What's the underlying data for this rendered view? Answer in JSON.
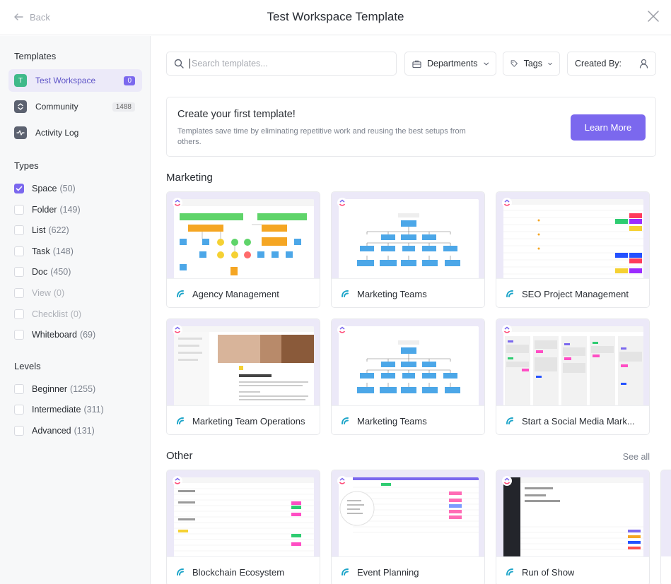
{
  "header": {
    "back_label": "Back",
    "title": "Test Workspace Template"
  },
  "sidebar": {
    "templates_title": "Templates",
    "nav": [
      {
        "label": "Test Workspace",
        "badge": "0",
        "icon": "workspace-avatar-T",
        "icon_letter": "T"
      },
      {
        "label": "Community",
        "badge": "1488",
        "icon": "community-icon"
      },
      {
        "label": "Activity Log",
        "badge": "",
        "icon": "activity-icon"
      }
    ],
    "types_title": "Types",
    "types": [
      {
        "label": "Space",
        "count": "(50)",
        "checked": true
      },
      {
        "label": "Folder",
        "count": "(149)"
      },
      {
        "label": "List",
        "count": "(622)"
      },
      {
        "label": "Task",
        "count": "(148)"
      },
      {
        "label": "Doc",
        "count": "(450)"
      },
      {
        "label": "View",
        "count": "(0)"
      },
      {
        "label": "Checklist",
        "count": "(0)"
      },
      {
        "label": "Whiteboard",
        "count": "(69)"
      }
    ],
    "levels_title": "Levels",
    "levels": [
      {
        "label": "Beginner",
        "count": "(1255)"
      },
      {
        "label": "Intermediate",
        "count": "(311)"
      },
      {
        "label": "Advanced",
        "count": "(131)"
      }
    ]
  },
  "toolbar": {
    "search_placeholder": "Search templates...",
    "departments_label": "Departments",
    "tags_label": "Tags",
    "created_by_label": "Created By:"
  },
  "banner": {
    "title": "Create your first template!",
    "description": "Templates save time by eliminating repetitive work and reusing the best setups from others.",
    "button_label": "Learn More"
  },
  "sections": {
    "marketing_title": "Marketing",
    "other_title": "Other",
    "see_all_label": "See all"
  },
  "cards": {
    "marketing": [
      {
        "name": "Agency Management",
        "preview": "flowchart"
      },
      {
        "name": "Marketing Teams",
        "preview": "org-chart"
      },
      {
        "name": "SEO Project Management",
        "preview": "table"
      },
      {
        "name": "Marketing Team Operations",
        "preview": "doc"
      },
      {
        "name": "Marketing Teams",
        "preview": "org-chart"
      },
      {
        "name": "Start a Social Media Mark...",
        "preview": "board"
      }
    ],
    "other": [
      {
        "name": "Blockchain Ecosystem",
        "preview": "list"
      },
      {
        "name": "Event Planning",
        "preview": "list-zoom"
      },
      {
        "name": "Run of Show",
        "preview": "dark-list"
      }
    ]
  },
  "colors": {
    "accent": "#7b68ee",
    "accent_light": "#eceaf9",
    "workspace_avatar": "#3fb98a",
    "preview_bg": "#ece9f8"
  }
}
